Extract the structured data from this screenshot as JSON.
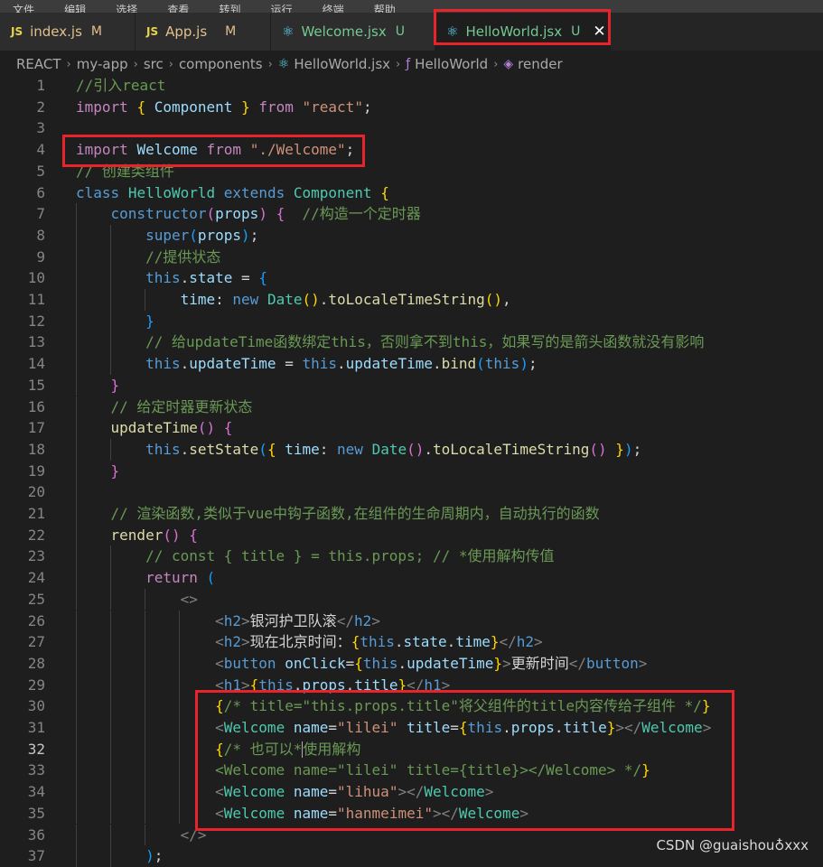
{
  "menubar": [
    "文件",
    "编辑",
    "选择",
    "查看",
    "转到",
    "运行",
    "终端",
    "帮助"
  ],
  "tabs": [
    {
      "label": "index.js",
      "status": "M",
      "icon": "js-icon",
      "active": false
    },
    {
      "label": "App.js",
      "status": "M",
      "icon": "js-icon",
      "active": false
    },
    {
      "label": "Welcome.jsx",
      "status": "U",
      "icon": "react-icon",
      "active": false
    },
    {
      "label": "HelloWorld.jsx",
      "status": "U",
      "icon": "react-icon",
      "active": true
    }
  ],
  "breadcrumb": [
    "REACT",
    "my-app",
    "src",
    "components",
    "HelloWorld.jsx",
    "HelloWorld",
    "render"
  ],
  "current_line": 32,
  "watermark": "CSDN @guaishou♁xxx",
  "colors": {
    "highlight_box": "#e8242a",
    "editor_bg": "#1e1e1e"
  }
}
